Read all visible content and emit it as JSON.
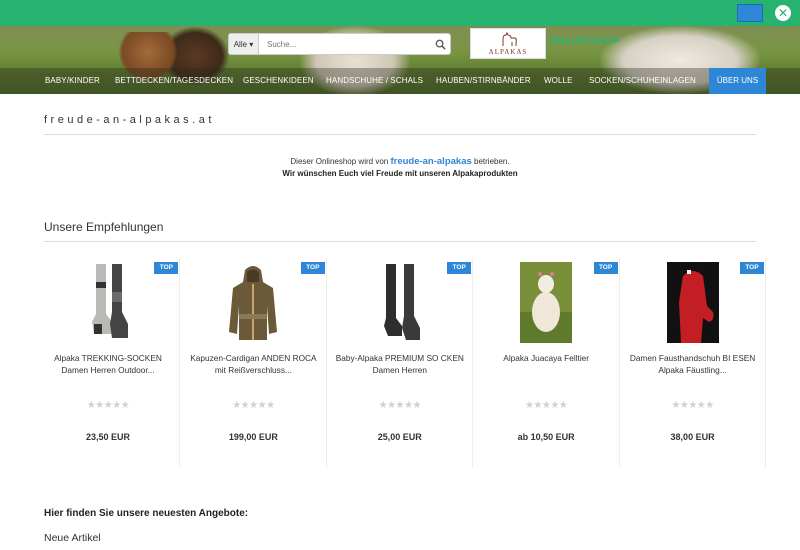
{
  "colors": {
    "banner": "#27b36f",
    "accent": "#2e86d6",
    "stars": "#cfcfcf"
  },
  "banner": {
    "close_icon": "close-icon"
  },
  "search": {
    "category": "Alle",
    "placeholder": "Suche..."
  },
  "logo": {
    "text": "ALPAKAS",
    "icon": "alpaca-logo-icon"
  },
  "onlineshop_label": "ONLINESHOP",
  "nav": {
    "items": [
      "BABY/KINDER",
      "BETTDECKEN/TAGESDECKEN",
      "GESCHENKIDEEN",
      "HANDSCHUHE / SCHALS",
      "HAUBEN/STIRNBÄNDER",
      "WOLLE",
      "SOCKEN/SCHUHEINLAGEN"
    ],
    "about": "ÜBER UNS"
  },
  "site_title": "freude-an-alpakas.at",
  "intro": {
    "line1_pre": "Dieser Onlineshop wird von",
    "brand": "freude-an-alpakas",
    "line1_post": "betrieben.",
    "line2": "Wir wünschen Euch viel Freude mit unseren Alpakaprodukten"
  },
  "recommendations": {
    "title": "Unsere Empfehlungen",
    "products": [
      {
        "badge": "TOP",
        "name": "Alpaka TREKKING-SOCKEN Damen Herren Outdoor...",
        "stars": "★★★★★",
        "price": "23,50 EUR",
        "image": "trekking-socks-image"
      },
      {
        "badge": "TOP",
        "name": "Kapuzen-Cardigan ANDEN ROCA mit Reißverschluss...",
        "stars": "★★★★★",
        "price": "199,00 EUR",
        "image": "cardigan-image"
      },
      {
        "badge": "TOP",
        "name": "Baby-Alpaka PREMIUM SO CKEN Damen Herren",
        "stars": "★★★★★",
        "price": "25,00 EUR",
        "image": "premium-socks-image"
      },
      {
        "badge": "TOP",
        "name": "Alpaka Juacaya Felltier",
        "stars": "★★★★★",
        "price": "ab 10,50 EUR",
        "image": "felltier-image"
      },
      {
        "badge": "TOP",
        "name": "Damen Fausthandschuh BI ESEN Alpaka Fäustling...",
        "stars": "★★★★★",
        "price": "38,00 EUR",
        "image": "mitten-image"
      }
    ]
  },
  "offers_heading": "Hier finden Sie unsere neuesten Angebote:",
  "new_items": "Neue Artikel"
}
